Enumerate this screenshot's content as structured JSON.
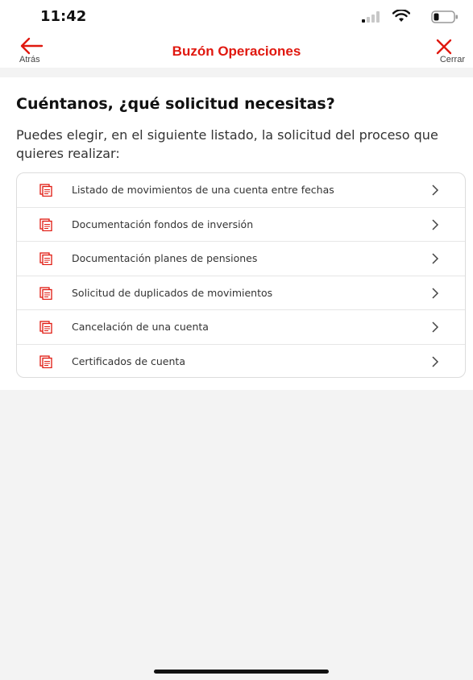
{
  "status_bar": {
    "time": "11:42"
  },
  "nav": {
    "back_label": "Atrás",
    "title": "Buzón Operaciones",
    "close_label": "Cerrar"
  },
  "content": {
    "heading": "Cuéntanos, ¿qué solicitud necesitas?",
    "subtitle": "Puedes elegir, en el siguiente listado, la solicitud del proceso que quieres realizar:",
    "items": [
      {
        "label": "Listado de movimientos de una cuenta entre fechas",
        "icon": "document-icon"
      },
      {
        "label": "Documentación fondos de inversión",
        "icon": "document-icon"
      },
      {
        "label": "Documentación planes de pensiones",
        "icon": "document-icon"
      },
      {
        "label": "Solicitud de duplicados de movimientos",
        "icon": "document-icon"
      },
      {
        "label": "Cancelación de una cuenta",
        "icon": "document-icon"
      },
      {
        "label": "Certificados de cuenta",
        "icon": "document-icon"
      }
    ]
  },
  "colors": {
    "brand": "#e0180f",
    "text": "#333333",
    "background": "#f3f3f3"
  }
}
